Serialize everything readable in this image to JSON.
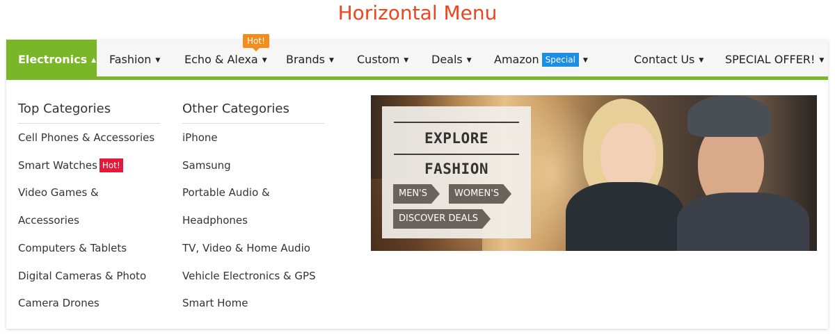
{
  "page": {
    "title": "Horizontal Menu"
  },
  "menu": {
    "items": [
      {
        "label": "Electronics",
        "caret": "▲"
      },
      {
        "label": "Fashion",
        "caret": "▼"
      },
      {
        "label": "Echo & Alexa",
        "caret": "▼",
        "badge": "Hot!"
      },
      {
        "label": "Brands",
        "caret": "▼"
      },
      {
        "label": "Custom",
        "caret": "▼"
      },
      {
        "label": "Deals",
        "caret": "▼"
      },
      {
        "label": "Amazon",
        "caret": "▼",
        "badge": "Special"
      },
      {
        "label": "Contact Us",
        "caret": "▼"
      },
      {
        "label": "SPECIAL OFFER!",
        "caret": "▼"
      }
    ],
    "colors": {
      "accent": "#7ab728",
      "hot_orange": "#f48b1a",
      "special_blue": "#1c8ee3",
      "hot_red": "#e21b3c"
    }
  },
  "dropdown": {
    "top": {
      "heading": "Top Categories",
      "links": [
        "Cell Phones & Accessories",
        "Smart Watches",
        "Video Games &",
        "Accessories",
        "Computers & Tablets",
        "Digital Cameras & Photo",
        "Camera Drones"
      ],
      "hot_badge": "Hot!"
    },
    "other": {
      "heading": "Other Categories",
      "links": [
        "iPhone",
        "Samsung",
        "Portable Audio &",
        "Headphones",
        "TV, Video & Home Audio",
        "Vehicle Electronics & GPS",
        "Smart Home"
      ]
    },
    "promo": {
      "title": "EXPLORE FASHION",
      "tags": [
        "MEN'S",
        "WOMEN'S",
        "DISCOVER DEALS"
      ]
    }
  }
}
